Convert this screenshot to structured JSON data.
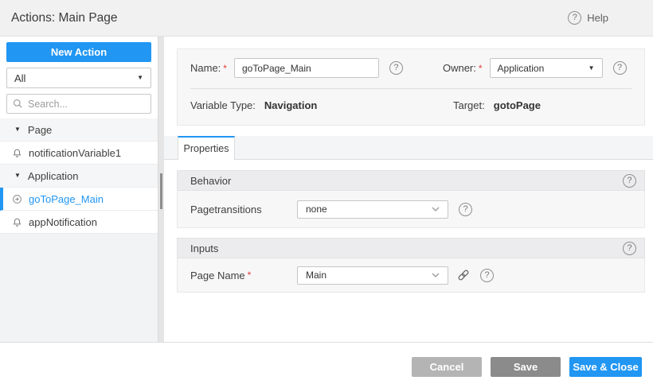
{
  "header": {
    "title": "Actions: Main Page",
    "help_label": "Help"
  },
  "icons": {
    "caret_down": "▼",
    "help_glyph": "?",
    "required_mark": "*"
  },
  "sidebar": {
    "new_action_label": "New Action",
    "filter_value": "All",
    "search_placeholder": "Search...",
    "tree": [
      {
        "label": "Page",
        "type": "group",
        "expanded": true
      },
      {
        "label": "notificationVariable1",
        "type": "item"
      },
      {
        "label": "Application",
        "type": "group",
        "expanded": true
      },
      {
        "label": "goToPage_Main",
        "type": "item",
        "selected": true
      },
      {
        "label": "appNotification",
        "type": "item"
      }
    ]
  },
  "form": {
    "name_label": "Name:",
    "name_value": "goToPage_Main",
    "owner_label": "Owner:",
    "owner_value": "Application",
    "variable_type_label": "Variable Type:",
    "variable_type_value": "Navigation",
    "target_label": "Target:",
    "target_value": "gotoPage"
  },
  "tabs": {
    "properties_label": "Properties"
  },
  "behavior": {
    "title": "Behavior",
    "pagetransitions_label": "Pagetransitions",
    "pagetransitions_value": "none"
  },
  "inputs": {
    "title": "Inputs",
    "page_name_label": "Page Name",
    "page_name_value": "Main"
  },
  "footer": {
    "cancel_label": "Cancel",
    "save_label": "Save",
    "save_close_label": "Save & Close"
  },
  "colors": {
    "accent": "#2196f3",
    "selected_item_text": "#2196f3",
    "cancel_button_bg": "#b4b4b4",
    "save_button_bg": "#8b8b8b",
    "required_mark_color": "#e53935"
  }
}
